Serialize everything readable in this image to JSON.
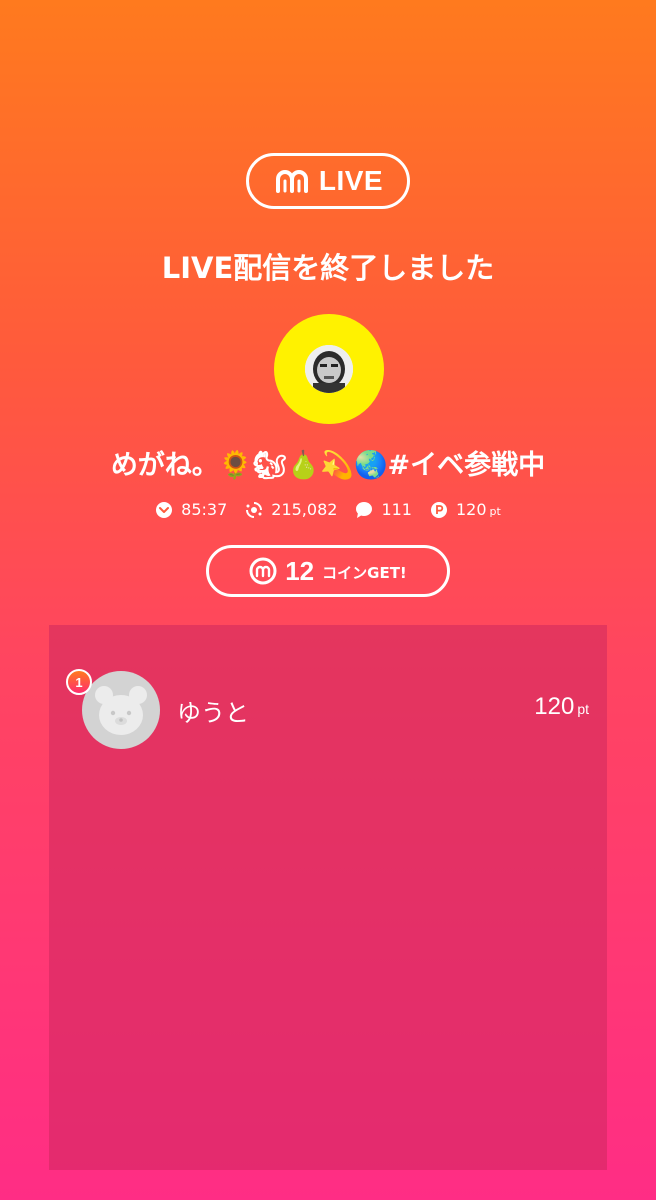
{
  "badge": {
    "label": "LIVE"
  },
  "end_message": "LIVE配信を終了しました",
  "streamer": {
    "name": "めがね。🌻🐿🍐💫🌏#イベ参戦中"
  },
  "stats": {
    "duration": "85:37",
    "viewers": "215,082",
    "comments": "111",
    "points": "120",
    "points_unit": "pt"
  },
  "coin": {
    "count": "12",
    "label": "コインGET!"
  },
  "ranking": [
    {
      "rank": "1",
      "name": "ゆうと",
      "points": "120",
      "unit": "pt"
    }
  ],
  "colors": {
    "gradient_top": "#ff7a1e",
    "gradient_bottom": "#ff2d85",
    "avatar_ring": "#fff200",
    "panel": "#cd285f"
  }
}
